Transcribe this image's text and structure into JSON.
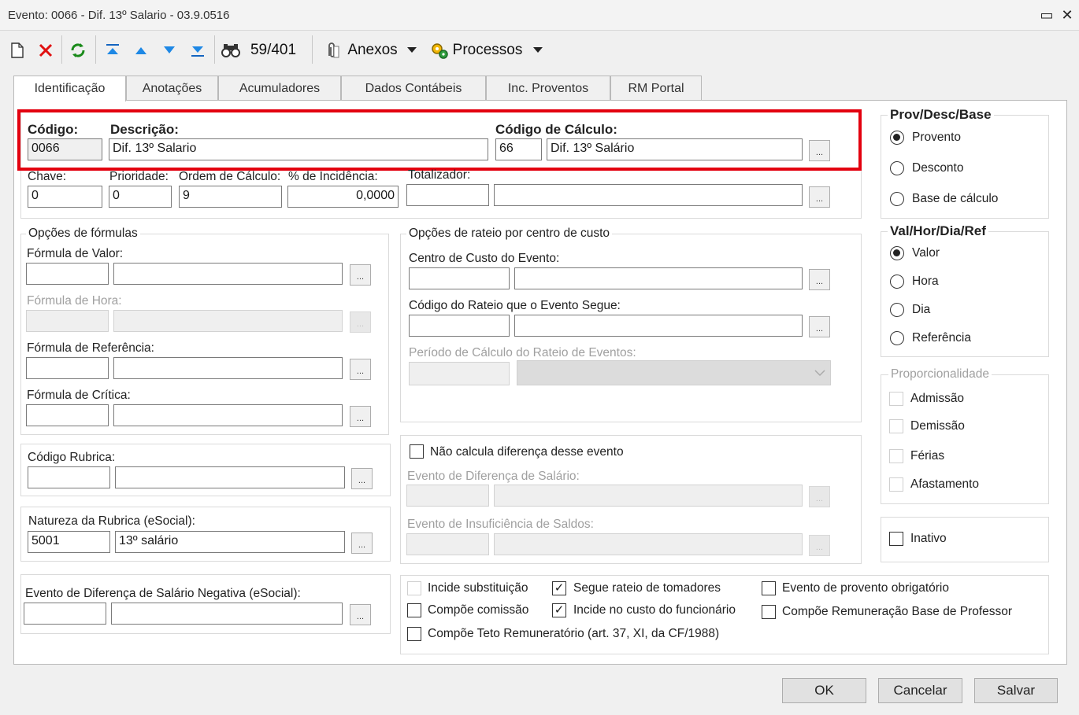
{
  "window": {
    "title": "Evento: 0066 - Dif. 13º Salario - 03.9.0516",
    "restore_icon": "▭",
    "close_icon": "✕"
  },
  "toolbar": {
    "record_counter": "59/401",
    "anexos_label": "Anexos",
    "processos_label": "Processos"
  },
  "tabs": [
    {
      "label": "Identificação"
    },
    {
      "label": "Anotações"
    },
    {
      "label": "Acumuladores"
    },
    {
      "label": "Dados Contábeis"
    },
    {
      "label": "Inc. Proventos"
    },
    {
      "label": "RM Portal"
    }
  ],
  "header": {
    "codigo_label": "Código:",
    "codigo_value": "0066",
    "descricao_label": "Descrição:",
    "descricao_value": "Dif. 13º Salario",
    "codigo_calculo_label": "Código de Cálculo:",
    "codigo_calculo_value": "66",
    "codigo_calculo_desc": "Dif. 13º Salário"
  },
  "row2": {
    "chave_label": "Chave:",
    "chave_value": "0",
    "prioridade_label": "Prioridade:",
    "prioridade_value": "0",
    "ordem_label": "Ordem de Cálculo:",
    "ordem_value": "9",
    "incidencia_label": "% de Incidência:",
    "incidencia_value": "0,0000",
    "totalizador_label": "Totalizador:"
  },
  "formulas": {
    "group_title": "Opções de fórmulas",
    "valor_label": "Fórmula de Valor:",
    "hora_label": "Fórmula de Hora:",
    "referencia_label": "Fórmula de Referência:",
    "critica_label": "Fórmula de Crítica:"
  },
  "rateio": {
    "group_title": "Opções de rateio por centro de custo",
    "centro_label": "Centro de Custo do Evento:",
    "codigo_rateio_label": "Código do Rateio que o Evento Segue:",
    "periodo_label": "Período de Cálculo do Rateio de Eventos:"
  },
  "rubrica": {
    "label": "Código Rubrica:"
  },
  "natureza": {
    "label": "Natureza da Rubrica (eSocial):",
    "code": "5001",
    "desc": "13º salário"
  },
  "dif_negativa": {
    "label": "Evento de Diferença de Salário Negativa (eSocial):"
  },
  "diferenca": {
    "nao_calcula_label": "Não calcula diferença desse evento",
    "evento_dif_label": "Evento de Diferença de Salário:",
    "evento_insuf_label": "Evento de Insuficiência de Saldos:"
  },
  "checks": {
    "incide_substituicao": "Incide substituição",
    "segue_rateio": "Segue rateio de tomadores",
    "evento_obrigatorio": "Evento de provento obrigatório",
    "compoe_comissao": "Compõe comissão",
    "incide_custo": "Incide no custo do funcionário",
    "compoe_remuneracao": "Compõe Remuneração Base de Professor",
    "compoe_teto": "Compõe Teto Remuneratório (art. 37, XI, da CF/1988)",
    "check_mark": "✓"
  },
  "prov_desc": {
    "title": "Prov/Desc/Base",
    "opt1": "Provento",
    "opt2": "Desconto",
    "opt3": "Base de cálculo"
  },
  "val_hor": {
    "title": "Val/Hor/Dia/Ref",
    "opt1": "Valor",
    "opt2": "Hora",
    "opt3": "Dia",
    "opt4": "Referência"
  },
  "proporcionalidade": {
    "title": "Proporcionalidade",
    "opt1": "Admissão",
    "opt2": "Demissão",
    "opt3": "Férias",
    "opt4": "Afastamento"
  },
  "inativo": {
    "label": "Inativo"
  },
  "buttons": {
    "ok": "OK",
    "cancel": "Cancelar",
    "save": "Salvar",
    "ellipsis": "..."
  }
}
